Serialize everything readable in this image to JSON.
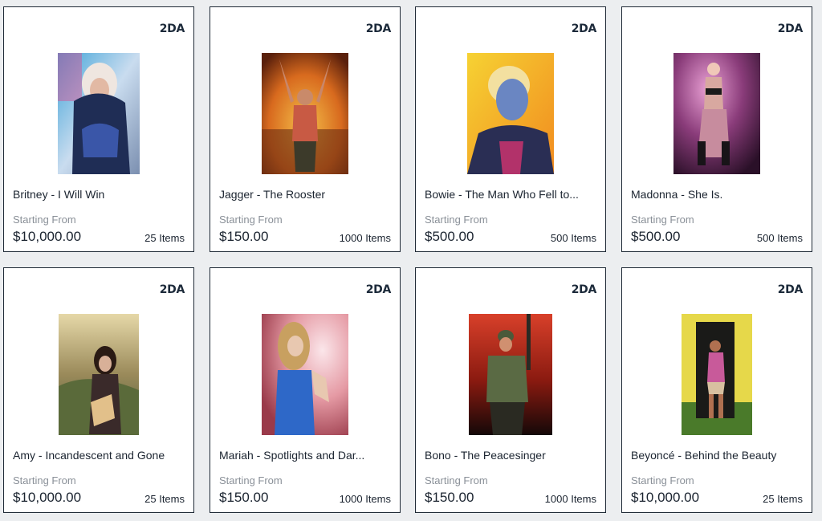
{
  "brand": "2DA",
  "starting_label": "Starting From",
  "cards": [
    {
      "title": "Britney - I Will Win",
      "price": "$10,000.00",
      "items": "25 Items",
      "art": "britney-artwork"
    },
    {
      "title": "Jagger - The Rooster",
      "price": "$150.00",
      "items": "1000 Items",
      "art": "jagger-artwork"
    },
    {
      "title": "Bowie - The Man Who Fell to...",
      "price": "$500.00",
      "items": "500 Items",
      "art": "bowie-artwork"
    },
    {
      "title": "Madonna - She Is.",
      "price": "$500.00",
      "items": "500 Items",
      "art": "madonna-artwork"
    },
    {
      "title": "Amy - Incandescent and Gone",
      "price": "$10,000.00",
      "items": "25 Items",
      "art": "amy-artwork"
    },
    {
      "title": "Mariah - Spotlights and Dar...",
      "price": "$150.00",
      "items": "1000 Items",
      "art": "mariah-artwork"
    },
    {
      "title": "Bono - The Peacesinger",
      "price": "$150.00",
      "items": "1000 Items",
      "art": "bono-artwork"
    },
    {
      "title": "Beyoncé - Behind the Beauty",
      "price": "$10,000.00",
      "items": "25 Items",
      "art": "beyonce-artwork"
    }
  ]
}
